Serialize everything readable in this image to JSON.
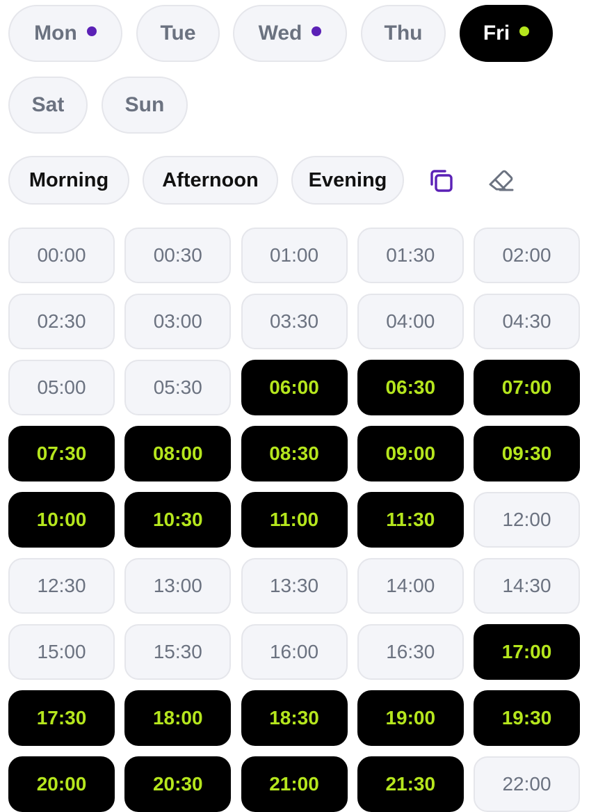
{
  "colors": {
    "accent_purple": "#5b21b6",
    "accent_lime": "#b5e61d",
    "selected_bg": "#000000",
    "unselected_bg": "#f4f5f9"
  },
  "days": [
    {
      "label": "Mon",
      "has_dot": true,
      "active": false
    },
    {
      "label": "Tue",
      "has_dot": false,
      "active": false
    },
    {
      "label": "Wed",
      "has_dot": true,
      "active": false
    },
    {
      "label": "Thu",
      "has_dot": false,
      "active": false
    },
    {
      "label": "Fri",
      "has_dot": true,
      "active": true
    },
    {
      "label": "Sat",
      "has_dot": false,
      "active": false
    },
    {
      "label": "Sun",
      "has_dot": false,
      "active": false
    }
  ],
  "periods": [
    {
      "label": "Morning"
    },
    {
      "label": "Afternoon"
    },
    {
      "label": "Evening"
    }
  ],
  "tools": {
    "copy_icon": "copy-icon",
    "clear_icon": "eraser-icon"
  },
  "slots": [
    {
      "time": "00:00",
      "selected": false
    },
    {
      "time": "00:30",
      "selected": false
    },
    {
      "time": "01:00",
      "selected": false
    },
    {
      "time": "01:30",
      "selected": false
    },
    {
      "time": "02:00",
      "selected": false
    },
    {
      "time": "02:30",
      "selected": false
    },
    {
      "time": "03:00",
      "selected": false
    },
    {
      "time": "03:30",
      "selected": false
    },
    {
      "time": "04:00",
      "selected": false
    },
    {
      "time": "04:30",
      "selected": false
    },
    {
      "time": "05:00",
      "selected": false
    },
    {
      "time": "05:30",
      "selected": false
    },
    {
      "time": "06:00",
      "selected": true
    },
    {
      "time": "06:30",
      "selected": true
    },
    {
      "time": "07:00",
      "selected": true
    },
    {
      "time": "07:30",
      "selected": true
    },
    {
      "time": "08:00",
      "selected": true
    },
    {
      "time": "08:30",
      "selected": true
    },
    {
      "time": "09:00",
      "selected": true
    },
    {
      "time": "09:30",
      "selected": true
    },
    {
      "time": "10:00",
      "selected": true
    },
    {
      "time": "10:30",
      "selected": true
    },
    {
      "time": "11:00",
      "selected": true
    },
    {
      "time": "11:30",
      "selected": true
    },
    {
      "time": "12:00",
      "selected": false
    },
    {
      "time": "12:30",
      "selected": false
    },
    {
      "time": "13:00",
      "selected": false
    },
    {
      "time": "13:30",
      "selected": false
    },
    {
      "time": "14:00",
      "selected": false
    },
    {
      "time": "14:30",
      "selected": false
    },
    {
      "time": "15:00",
      "selected": false
    },
    {
      "time": "15:30",
      "selected": false
    },
    {
      "time": "16:00",
      "selected": false
    },
    {
      "time": "16:30",
      "selected": false
    },
    {
      "time": "17:00",
      "selected": true
    },
    {
      "time": "17:30",
      "selected": true
    },
    {
      "time": "18:00",
      "selected": true
    },
    {
      "time": "18:30",
      "selected": true
    },
    {
      "time": "19:00",
      "selected": true
    },
    {
      "time": "19:30",
      "selected": true
    },
    {
      "time": "20:00",
      "selected": true
    },
    {
      "time": "20:30",
      "selected": true
    },
    {
      "time": "21:00",
      "selected": true
    },
    {
      "time": "21:30",
      "selected": true
    },
    {
      "time": "22:00",
      "selected": false
    }
  ]
}
